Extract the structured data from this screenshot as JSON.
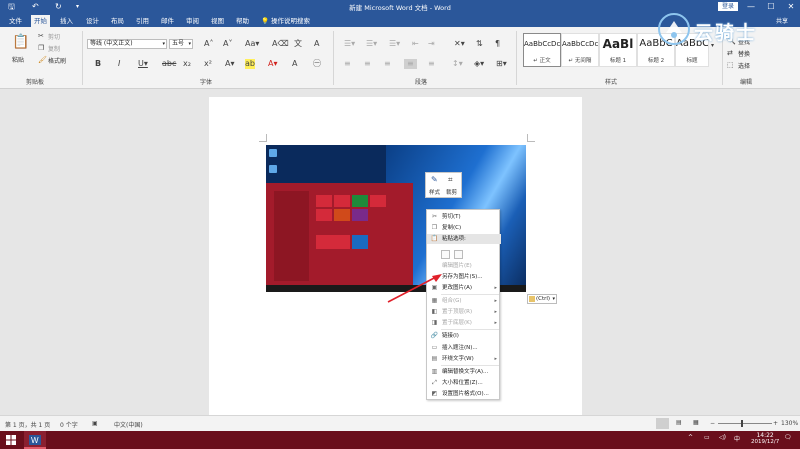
{
  "window": {
    "title": "新建 Microsoft Word 文档 - Word",
    "login_label": "登录",
    "user_name": "共享"
  },
  "tabs": [
    {
      "label": "文件"
    },
    {
      "label": "开始"
    },
    {
      "label": "插入"
    },
    {
      "label": "设计"
    },
    {
      "label": "布局"
    },
    {
      "label": "引用"
    },
    {
      "label": "邮件"
    },
    {
      "label": "审阅"
    },
    {
      "label": "视图"
    },
    {
      "label": "帮助"
    },
    {
      "label": "操作说明搜索"
    }
  ],
  "clipboard": {
    "paste": "粘贴",
    "cut": "剪切",
    "copy": "复制",
    "format_painter": "格式刷",
    "group": "剪贴板"
  },
  "font": {
    "name": "等线 (中文正文)",
    "size": "五号",
    "group": "字体"
  },
  "paragraph": {
    "group": "段落"
  },
  "styles": {
    "group": "样式",
    "items": [
      {
        "sample": "AaBbCcDc",
        "name": "↵ 正文"
      },
      {
        "sample": "AaBbCcDc",
        "name": "↵ 无间隔"
      },
      {
        "sample": "AaBl",
        "name": "标题 1"
      },
      {
        "sample": "AaBbC",
        "name": "标题 2"
      },
      {
        "sample": "AaBbC",
        "name": "标题"
      }
    ]
  },
  "editing": {
    "find": "查找",
    "replace": "替换",
    "select": "选择",
    "group": "编辑"
  },
  "watermark": {
    "text": "云骑士"
  },
  "mini_toolbar": {
    "style": "样式",
    "crop": "裁剪"
  },
  "context_menu": {
    "items": [
      {
        "label": "剪切(T)",
        "icon": "scissors-icon",
        "disabled": false
      },
      {
        "label": "复制(C)",
        "icon": "copy-icon",
        "disabled": false
      },
      {
        "label": "粘贴选项:",
        "icon": "paste-icon",
        "disabled": false
      },
      {
        "label": "编辑图片(E)",
        "icon": "",
        "disabled": true
      },
      {
        "label": "另存为图片(S)...",
        "icon": "",
        "disabled": false
      },
      {
        "label": "更改图片(A)",
        "icon": "image-icon",
        "disabled": false,
        "submenu": true
      },
      {
        "label": "组合(G)",
        "icon": "group-icon",
        "disabled": true,
        "submenu": true
      },
      {
        "label": "置于顶层(R)",
        "icon": "front-icon",
        "disabled": true,
        "submenu": true
      },
      {
        "label": "置于底层(K)",
        "icon": "back-icon",
        "disabled": true,
        "submenu": true
      },
      {
        "label": "链接(I)",
        "icon": "link-icon",
        "disabled": false
      },
      {
        "label": "插入题注(N)...",
        "icon": "caption-icon",
        "disabled": false
      },
      {
        "label": "环绕文字(W)",
        "icon": "wrap-icon",
        "disabled": false,
        "submenu": true
      },
      {
        "label": "编辑替换文字(A)...",
        "icon": "alt-text-icon",
        "disabled": false
      },
      {
        "label": "大小和位置(Z)...",
        "icon": "size-icon",
        "disabled": false
      },
      {
        "label": "设置图片格式(O)...",
        "icon": "format-icon",
        "disabled": false
      }
    ]
  },
  "ctrl_tag": "(Ctrl)",
  "status": {
    "page": "第 1 页，共 1 页",
    "words": "0 个字",
    "language": "中文(中国)",
    "zoom": "130%"
  },
  "taskbar": {
    "time": "14:22",
    "date": "2019/12/7",
    "ime": "中"
  },
  "colors": {
    "word_blue": "#2b579a",
    "taskbar": "#6a0f1c",
    "arrow": "#e0202a"
  }
}
